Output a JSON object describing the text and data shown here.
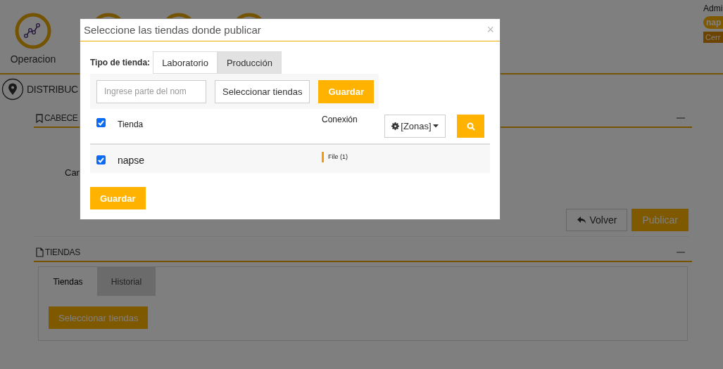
{
  "header": {
    "nav": [
      {
        "label": "Operacion"
      }
    ],
    "user": {
      "name": "Admi",
      "badge": "nap",
      "logout": "Cerr"
    }
  },
  "page": {
    "title": "DISTRIBUC",
    "header_section": {
      "title": "CABECE",
      "field_label": "Can"
    },
    "actions": [
      {
        "label": "Volver",
        "kind": "back"
      },
      {
        "label": "Publicar",
        "kind": "primary"
      }
    ],
    "stores_section": {
      "title": "TIENDAS",
      "tabs": [
        {
          "label": "Tiendas",
          "selected": true
        },
        {
          "label": "Historial",
          "selected": false
        }
      ],
      "button": "Seleccionar tiendas"
    }
  },
  "modal": {
    "title": "Seleccione las tiendas donde publicar",
    "close": "×",
    "store_type_label": "Tipo de tienda:",
    "store_types": [
      {
        "label": "Laboratorio",
        "selected": false
      },
      {
        "label": "Producción",
        "selected": true
      }
    ],
    "search": {
      "placeholder": "Ingrese parte del nom"
    },
    "select_button": "Seleccionar tiendas",
    "save_button": "Guardar",
    "table": {
      "select_all": true,
      "columns": [
        "Tienda",
        "Conexión"
      ],
      "zones_button": "[Zonas]",
      "rows": [
        {
          "checked": true,
          "name": "napse",
          "connection": "File (1)"
        }
      ]
    },
    "footer_button": "Guardar"
  }
}
